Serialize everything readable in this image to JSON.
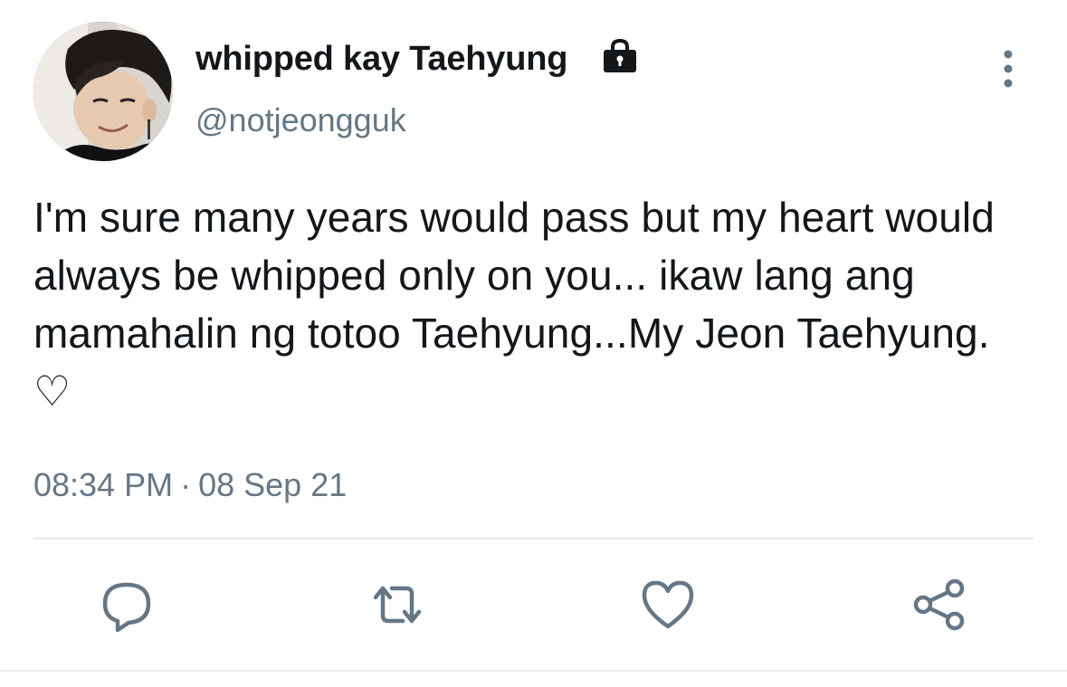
{
  "user": {
    "display_name": "whipped kay Taehyung",
    "handle": "@notjeongguk",
    "protected": true,
    "avatar_icon": "profile-photo"
  },
  "tweet": {
    "text": "I'm sure many years would pass but my heart would always be whipped only on you... ikaw lang ang mamahalin ng totoo Taehyung...My Jeon Taehyung. ♡",
    "time": "08:34 PM",
    "separator": "·",
    "date": "08 Sep 21"
  },
  "actions": {
    "reply_icon": "reply-icon",
    "retweet_icon": "retweet-icon",
    "like_icon": "heart-icon",
    "share_icon": "share-icon",
    "more_icon": "more-vertical-icon"
  },
  "colors": {
    "text_primary": "#14171a",
    "text_secondary": "#657786",
    "icon": "#657786",
    "divider": "#e1e8ed"
  }
}
